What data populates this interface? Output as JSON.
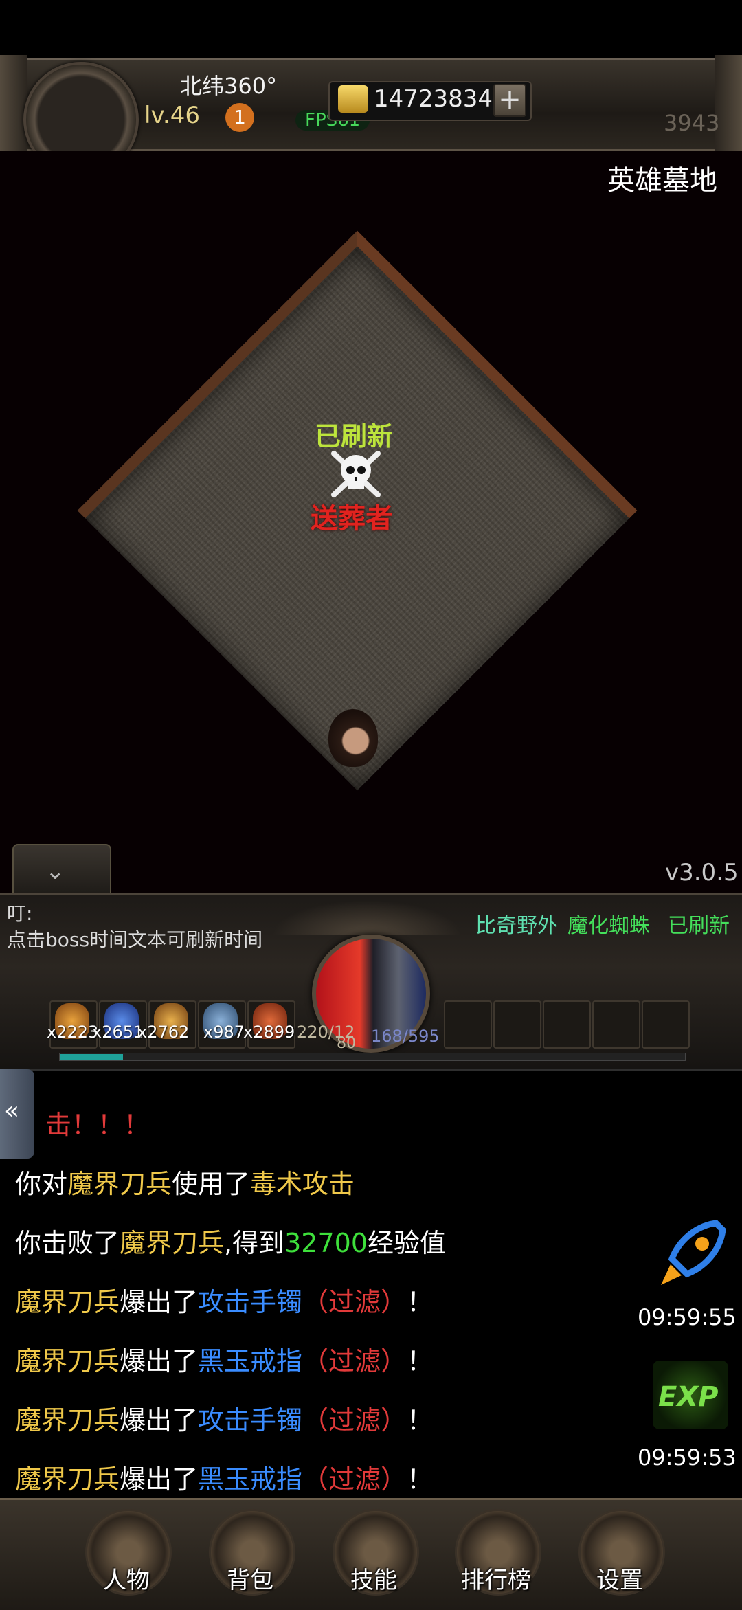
{
  "header": {
    "coords": "北纬360°",
    "level": "lv.46",
    "badge_count": "1",
    "fps": "FPS61",
    "gold": "14723834",
    "gold_add": "+",
    "power": "3943"
  },
  "map": {
    "name": "英雄墓地",
    "boss_status": "已刷新",
    "boss_name": "送葬者"
  },
  "version": "v3.0.5",
  "notice": {
    "title": "叮:",
    "text": "点击boss时间文本可刷新时间"
  },
  "boss_info": {
    "location": "比奇野外",
    "boss": "魔化蜘蛛",
    "status": "已刷新"
  },
  "belt": {
    "counts": [
      "x2223",
      "x2651",
      "x2762",
      "x987",
      "x2899"
    ],
    "hp": "220/12",
    "hp_max": "80",
    "mp": "168/595",
    "exp_progress": 0.1
  },
  "chat": [
    {
      "parts": [
        {
          "t": "击！！！",
          "c": "r"
        }
      ]
    },
    {
      "parts": [
        {
          "t": "你对",
          "c": "w"
        },
        {
          "t": "魔界刀兵",
          "c": "y"
        },
        {
          "t": "使用了",
          "c": "w"
        },
        {
          "t": "毒术攻击",
          "c": "y"
        }
      ]
    },
    {
      "parts": [
        {
          "t": "你击败了",
          "c": "w"
        },
        {
          "t": "魔界刀兵",
          "c": "y"
        },
        {
          "t": ",得到",
          "c": "w"
        },
        {
          "t": "32700",
          "c": "g"
        },
        {
          "t": "经验值",
          "c": "w"
        }
      ]
    },
    {
      "parts": [
        {
          "t": "魔界刀兵",
          "c": "y"
        },
        {
          "t": "爆出了",
          "c": "w"
        },
        {
          "t": "攻击手镯",
          "c": "b"
        },
        {
          "t": "（过滤）",
          "c": "r"
        },
        {
          "t": "！",
          "c": "w"
        }
      ]
    },
    {
      "parts": [
        {
          "t": "魔界刀兵",
          "c": "y"
        },
        {
          "t": "爆出了",
          "c": "w"
        },
        {
          "t": "黑玉戒指",
          "c": "b"
        },
        {
          "t": "（过滤）",
          "c": "r"
        },
        {
          "t": "！",
          "c": "w"
        }
      ]
    },
    {
      "parts": [
        {
          "t": "魔界刀兵",
          "c": "y"
        },
        {
          "t": "爆出了",
          "c": "w"
        },
        {
          "t": "攻击手镯",
          "c": "b"
        },
        {
          "t": "（过滤）",
          "c": "r"
        },
        {
          "t": "！",
          "c": "w"
        }
      ]
    },
    {
      "parts": [
        {
          "t": "魔界刀兵",
          "c": "y"
        },
        {
          "t": "爆出了",
          "c": "w"
        },
        {
          "t": "黑玉戒指",
          "c": "b"
        },
        {
          "t": "（过滤）",
          "c": "r"
        },
        {
          "t": "！",
          "c": "w"
        }
      ]
    }
  ],
  "timers": {
    "rocket_time": "09:59:55",
    "exp_time": "09:59:53",
    "exp_label": "EXP"
  },
  "nav": [
    {
      "label": "人物",
      "icon": "character-icon"
    },
    {
      "label": "背包",
      "icon": "backpack-icon"
    },
    {
      "label": "技能",
      "icon": "skills-icon"
    },
    {
      "label": "排行榜",
      "icon": "ranking-icon"
    },
    {
      "label": "设置",
      "icon": "settings-icon"
    }
  ],
  "colors": {
    "gold": "#f0c94a",
    "green": "#3ee03b",
    "blue": "#3a8cff",
    "red": "#e23a3a"
  }
}
